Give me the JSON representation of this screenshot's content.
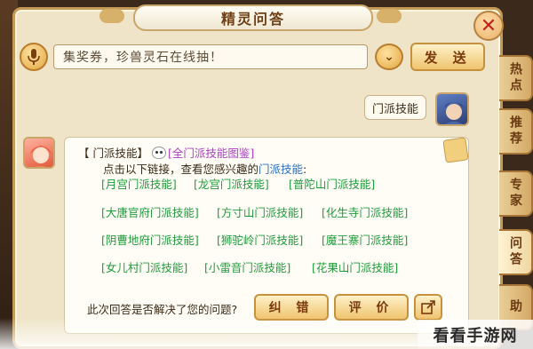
{
  "window": {
    "title": "精灵问答",
    "close_glyph": "✕"
  },
  "input_bar": {
    "value": "集奖券，珍兽灵石在线抽！",
    "send_label": "发 送",
    "dropdown_glyph": "⌄"
  },
  "side_tabs": [
    {
      "label": "热点",
      "active": false
    },
    {
      "label": "推荐",
      "active": false
    },
    {
      "label": "专家",
      "active": false
    },
    {
      "label": "问答",
      "active": true
    },
    {
      "label": "助",
      "active": false
    }
  ],
  "question": {
    "text": "门派技能"
  },
  "answer": {
    "prefix": "【 门派技能】",
    "all_link": "[全门派技能图鉴]",
    "prompt": "点击以下链接，查看您感兴趣的",
    "prompt_keyword": "门派技能",
    "prompt_suffix": ":",
    "links": [
      [
        "[月宫门派技能]",
        "[龙宫门派技能]",
        "[普陀山门派技能]"
      ],
      [
        "[大唐官府门派技能]",
        "[方寸山门派技能]",
        "[化生寺门派技能]"
      ],
      [
        "[阴曹地府门派技能]",
        "[狮驼岭门派技能]",
        "[魔王寨门派技能]"
      ],
      [
        "[女儿村门派技能]",
        "[小雷音门派技能]",
        "[花果山门派技能]"
      ]
    ]
  },
  "feedback": {
    "question": "此次回答是否解决了您的问题?",
    "correct_label": "纠 错",
    "rate_label": "评 价"
  },
  "watermark": {
    "text": "看看手游网"
  }
}
